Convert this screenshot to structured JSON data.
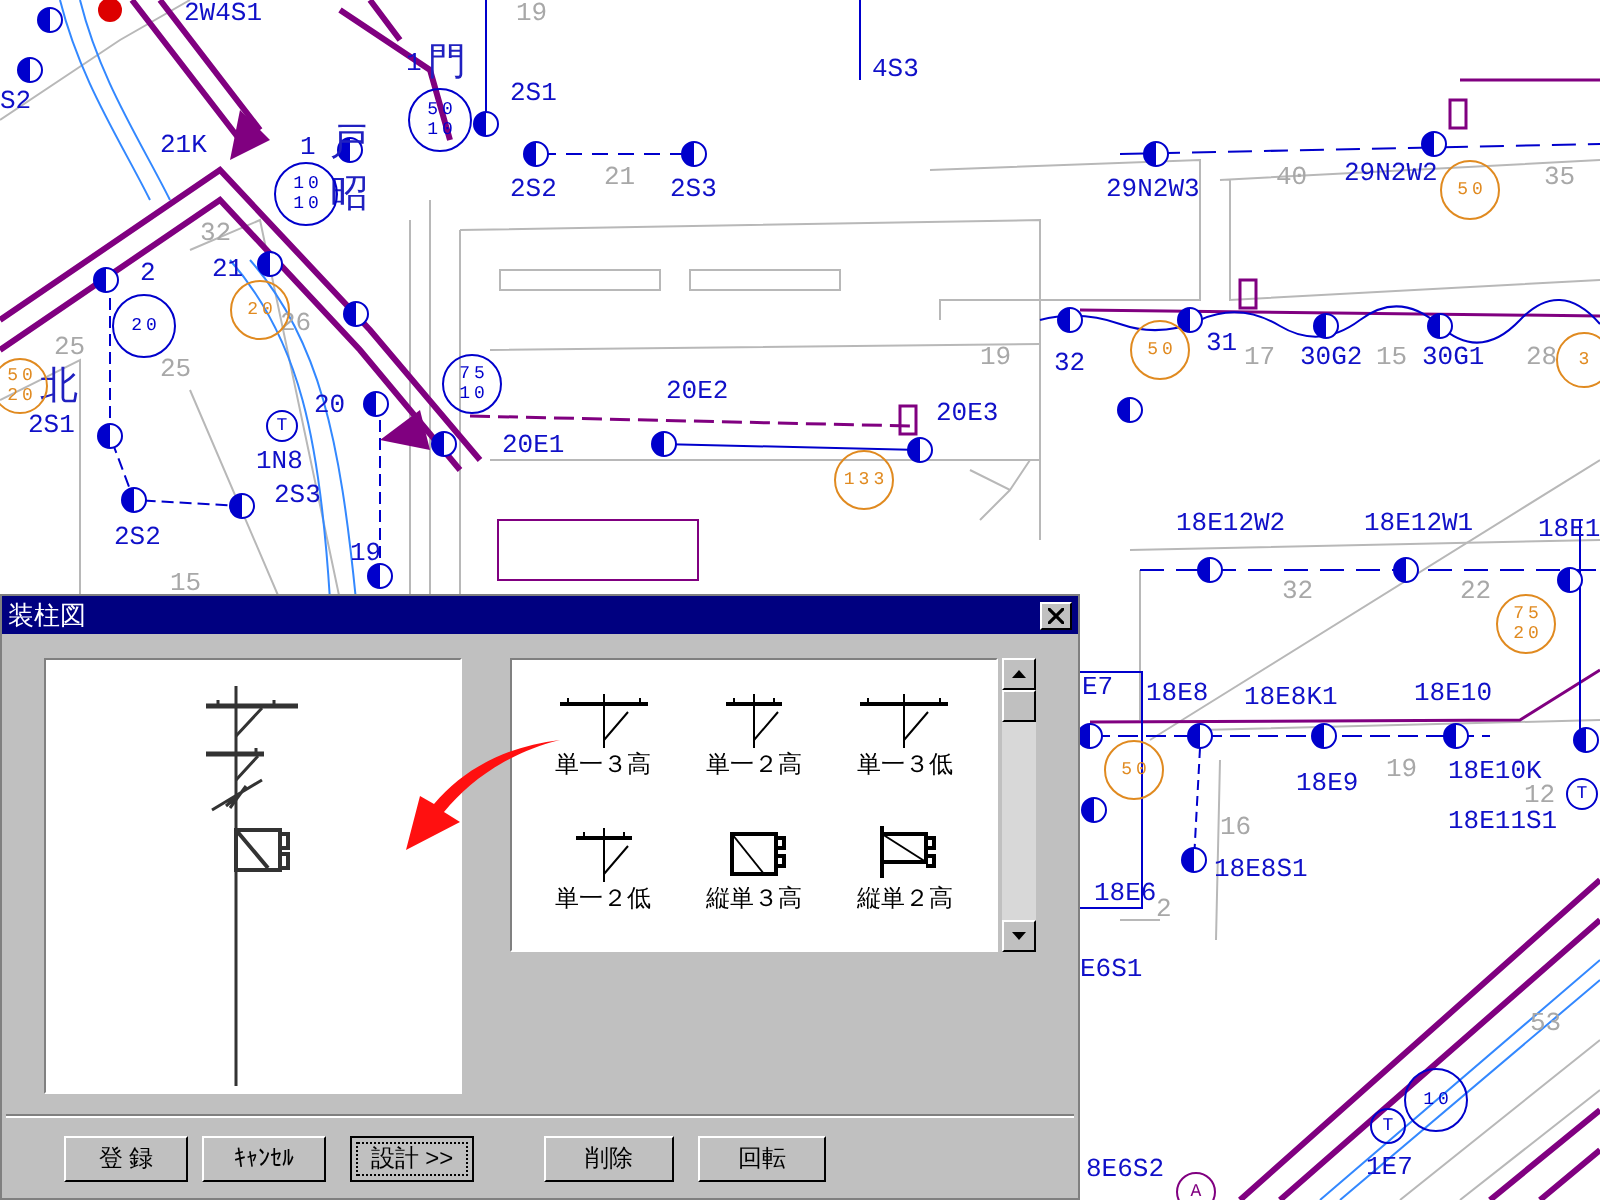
{
  "map": {
    "labels": [
      {
        "text": "2W4S1",
        "kind": "id"
      },
      {
        "text": "S2",
        "kind": "id"
      },
      {
        "text": "1",
        "kind": "id"
      },
      {
        "text": "2S1",
        "kind": "id"
      },
      {
        "text": "4S3",
        "kind": "id"
      },
      {
        "text": "21K",
        "kind": "id"
      },
      {
        "text": "1",
        "kind": "id"
      },
      {
        "text": "2S2",
        "kind": "id"
      },
      {
        "text": "2S3",
        "kind": "id"
      },
      {
        "text": "29N2W3",
        "kind": "id"
      },
      {
        "text": "29N2W2",
        "kind": "id"
      },
      {
        "text": "2",
        "kind": "id"
      },
      {
        "text": "21",
        "kind": "id"
      },
      {
        "text": "20",
        "kind": "id"
      },
      {
        "text": "1N8",
        "kind": "id"
      },
      {
        "text": "2S3",
        "kind": "id"
      },
      {
        "text": "2S1",
        "kind": "id"
      },
      {
        "text": "2S2",
        "kind": "id"
      },
      {
        "text": "19",
        "kind": "id"
      },
      {
        "text": "20E2",
        "kind": "id"
      },
      {
        "text": "20E1",
        "kind": "id"
      },
      {
        "text": "20E3",
        "kind": "id"
      },
      {
        "text": "32",
        "kind": "id"
      },
      {
        "text": "31",
        "kind": "id"
      },
      {
        "text": "30G2",
        "kind": "id"
      },
      {
        "text": "30G1",
        "kind": "id"
      },
      {
        "text": "18E12W2",
        "kind": "id"
      },
      {
        "text": "18E12W1",
        "kind": "id"
      },
      {
        "text": "18E1",
        "kind": "id"
      },
      {
        "text": "E7",
        "kind": "id"
      },
      {
        "text": "18E8",
        "kind": "id"
      },
      {
        "text": "18E8K1",
        "kind": "id"
      },
      {
        "text": "18E10",
        "kind": "id"
      },
      {
        "text": "18E9",
        "kind": "id"
      },
      {
        "text": "18E10K",
        "kind": "id"
      },
      {
        "text": "18E11S1",
        "kind": "id"
      },
      {
        "text": "18E8S1",
        "kind": "id"
      },
      {
        "text": "18E6",
        "kind": "id"
      },
      {
        "text": "E6S1",
        "kind": "id"
      },
      {
        "text": "1E7",
        "kind": "id"
      },
      {
        "text": "8E6S2",
        "kind": "id"
      },
      {
        "text": "門",
        "kind": "place"
      },
      {
        "text": "戸",
        "kind": "place"
      },
      {
        "text": "昭",
        "kind": "place"
      },
      {
        "text": "北",
        "kind": "place"
      },
      {
        "text": "19",
        "kind": "span"
      },
      {
        "text": "21",
        "kind": "span"
      },
      {
        "text": "40",
        "kind": "span"
      },
      {
        "text": "35",
        "kind": "span"
      },
      {
        "text": "32",
        "kind": "span"
      },
      {
        "text": "25",
        "kind": "span"
      },
      {
        "text": "25",
        "kind": "span"
      },
      {
        "text": "26",
        "kind": "span"
      },
      {
        "text": "15",
        "kind": "span"
      },
      {
        "text": "19",
        "kind": "span"
      },
      {
        "text": "17",
        "kind": "span"
      },
      {
        "text": "15",
        "kind": "span"
      },
      {
        "text": "28",
        "kind": "span"
      },
      {
        "text": "32",
        "kind": "span"
      },
      {
        "text": "22",
        "kind": "span"
      },
      {
        "text": "16",
        "kind": "span"
      },
      {
        "text": "19",
        "kind": "span"
      },
      {
        "text": "12",
        "kind": "span"
      },
      {
        "text": "2",
        "kind": "span"
      },
      {
        "text": "53",
        "kind": "span"
      }
    ],
    "markers": [
      {
        "lines": [
          "50",
          "10"
        ],
        "color": "#0000cc"
      },
      {
        "lines": [
          "10",
          "10"
        ],
        "color": "#0000cc"
      },
      {
        "lines": [
          "50"
        ],
        "color": "#e08a20"
      },
      {
        "lines": [
          "20"
        ],
        "color": "#0000cc"
      },
      {
        "lines": [
          "20"
        ],
        "color": "#e08a20"
      },
      {
        "lines": [
          "50"
        ],
        "color": "#e08a20"
      },
      {
        "lines": [
          "3"
        ],
        "color": "#e08a20"
      },
      {
        "lines": [
          "50",
          "20"
        ],
        "color": "#e08a20"
      },
      {
        "lines": [
          "75",
          "10"
        ],
        "color": "#0000cc"
      },
      {
        "lines": [
          "T"
        ],
        "color": "#0000cc"
      },
      {
        "lines": [
          "133"
        ],
        "color": "#e08a20"
      },
      {
        "lines": [
          "75",
          "20"
        ],
        "color": "#e08a20"
      },
      {
        "lines": [
          "50"
        ],
        "color": "#e08a20"
      },
      {
        "lines": [
          "T"
        ],
        "color": "#0000cc"
      },
      {
        "lines": [
          "10"
        ],
        "color": "#0000cc"
      },
      {
        "lines": [
          "T"
        ],
        "color": "#0000cc"
      },
      {
        "lines": [
          "A"
        ],
        "color": "#800080"
      }
    ]
  },
  "dialog": {
    "title": "装柱図",
    "symbols": [
      {
        "label": "単一３高",
        "kind": "arm3"
      },
      {
        "label": "単一２高",
        "kind": "arm2"
      },
      {
        "label": "単一３低",
        "kind": "arm3low"
      },
      {
        "label": "単一２低",
        "kind": "arm2low"
      },
      {
        "label": "縦単３高",
        "kind": "box3"
      },
      {
        "label": "縦単２高",
        "kind": "box2"
      }
    ],
    "buttons": [
      {
        "label": "登 録",
        "focused": false
      },
      {
        "label": "ｷｬﾝｾﾙ",
        "focused": false
      },
      {
        "label": "設計 >>",
        "focused": true
      },
      {
        "label": "削除",
        "focused": false
      },
      {
        "label": "回転",
        "focused": false
      }
    ]
  }
}
